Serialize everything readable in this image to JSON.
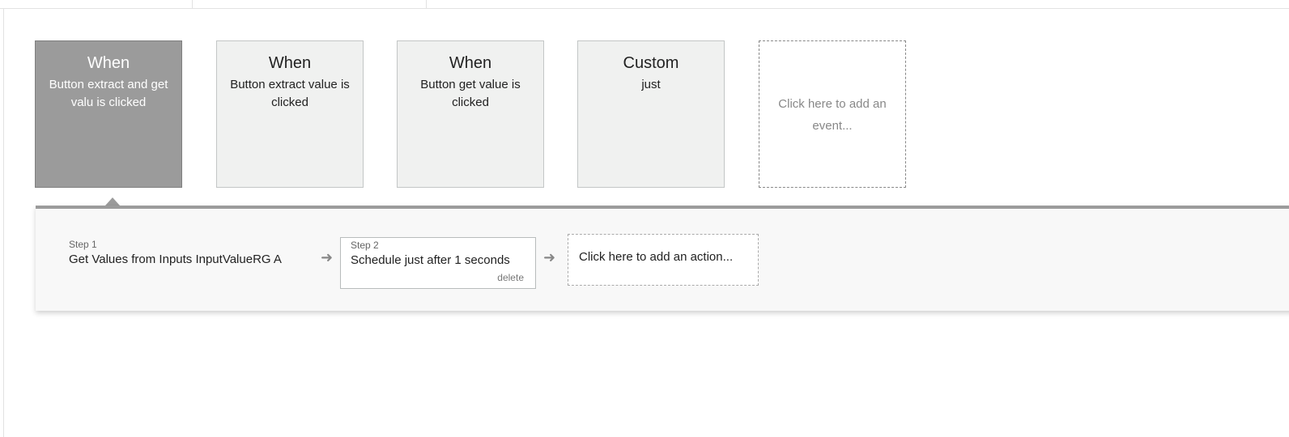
{
  "events": [
    {
      "title": "When",
      "description": "Button extract and get valu is clicked",
      "selected": true
    },
    {
      "title": "When",
      "description": "Button extract value is clicked",
      "selected": false
    },
    {
      "title": "When",
      "description": "Button get value is clicked",
      "selected": false
    },
    {
      "title": "Custom",
      "description": "just",
      "selected": false
    }
  ],
  "add_event_label": "Click here to add an event...",
  "steps": [
    {
      "number": "Step 1",
      "text": "Get Values from Inputs InputValueRG A"
    },
    {
      "number": "Step 2",
      "text": "Schedule just after 1 seconds",
      "delete_label": "delete"
    }
  ],
  "add_action_label": "Click here to add an action...",
  "icons": {
    "arrow": "arrow-right-icon"
  }
}
